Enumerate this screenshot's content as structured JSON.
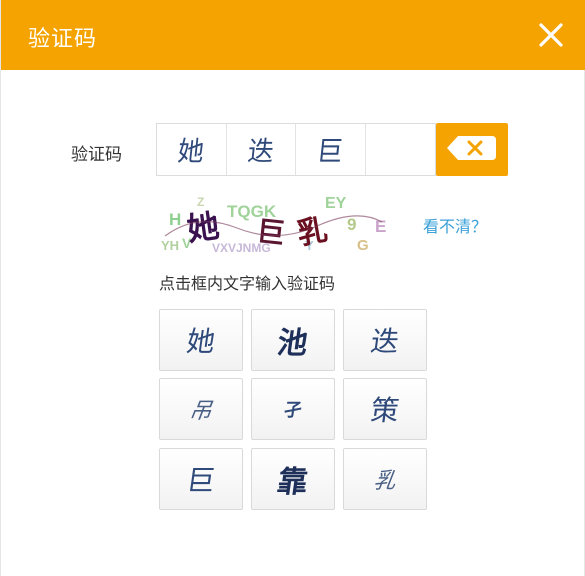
{
  "dialog": {
    "title": "验证码",
    "close_icon": "close-icon"
  },
  "input": {
    "label": "验证码",
    "slots": [
      "她",
      "迭",
      "巨",
      ""
    ],
    "backspace_icon": "backspace-icon"
  },
  "captcha": {
    "main_chars": [
      "她",
      "巨",
      "乳"
    ],
    "noise": [
      "TQGK",
      "EY",
      "H",
      "V",
      "9",
      "E",
      "G",
      "YH",
      "VXVJNMG",
      "Z",
      "Y"
    ]
  },
  "refresh_label": "看不清？",
  "hint": "点击框内文字输入验证码",
  "choices": [
    "她",
    "池",
    "迭",
    "吊",
    "孑",
    "策",
    "巨",
    "靠",
    "乳"
  ],
  "colors": {
    "accent": "#f5a300",
    "link": "#3aa0d8",
    "glyph": "#2f4a7a"
  }
}
